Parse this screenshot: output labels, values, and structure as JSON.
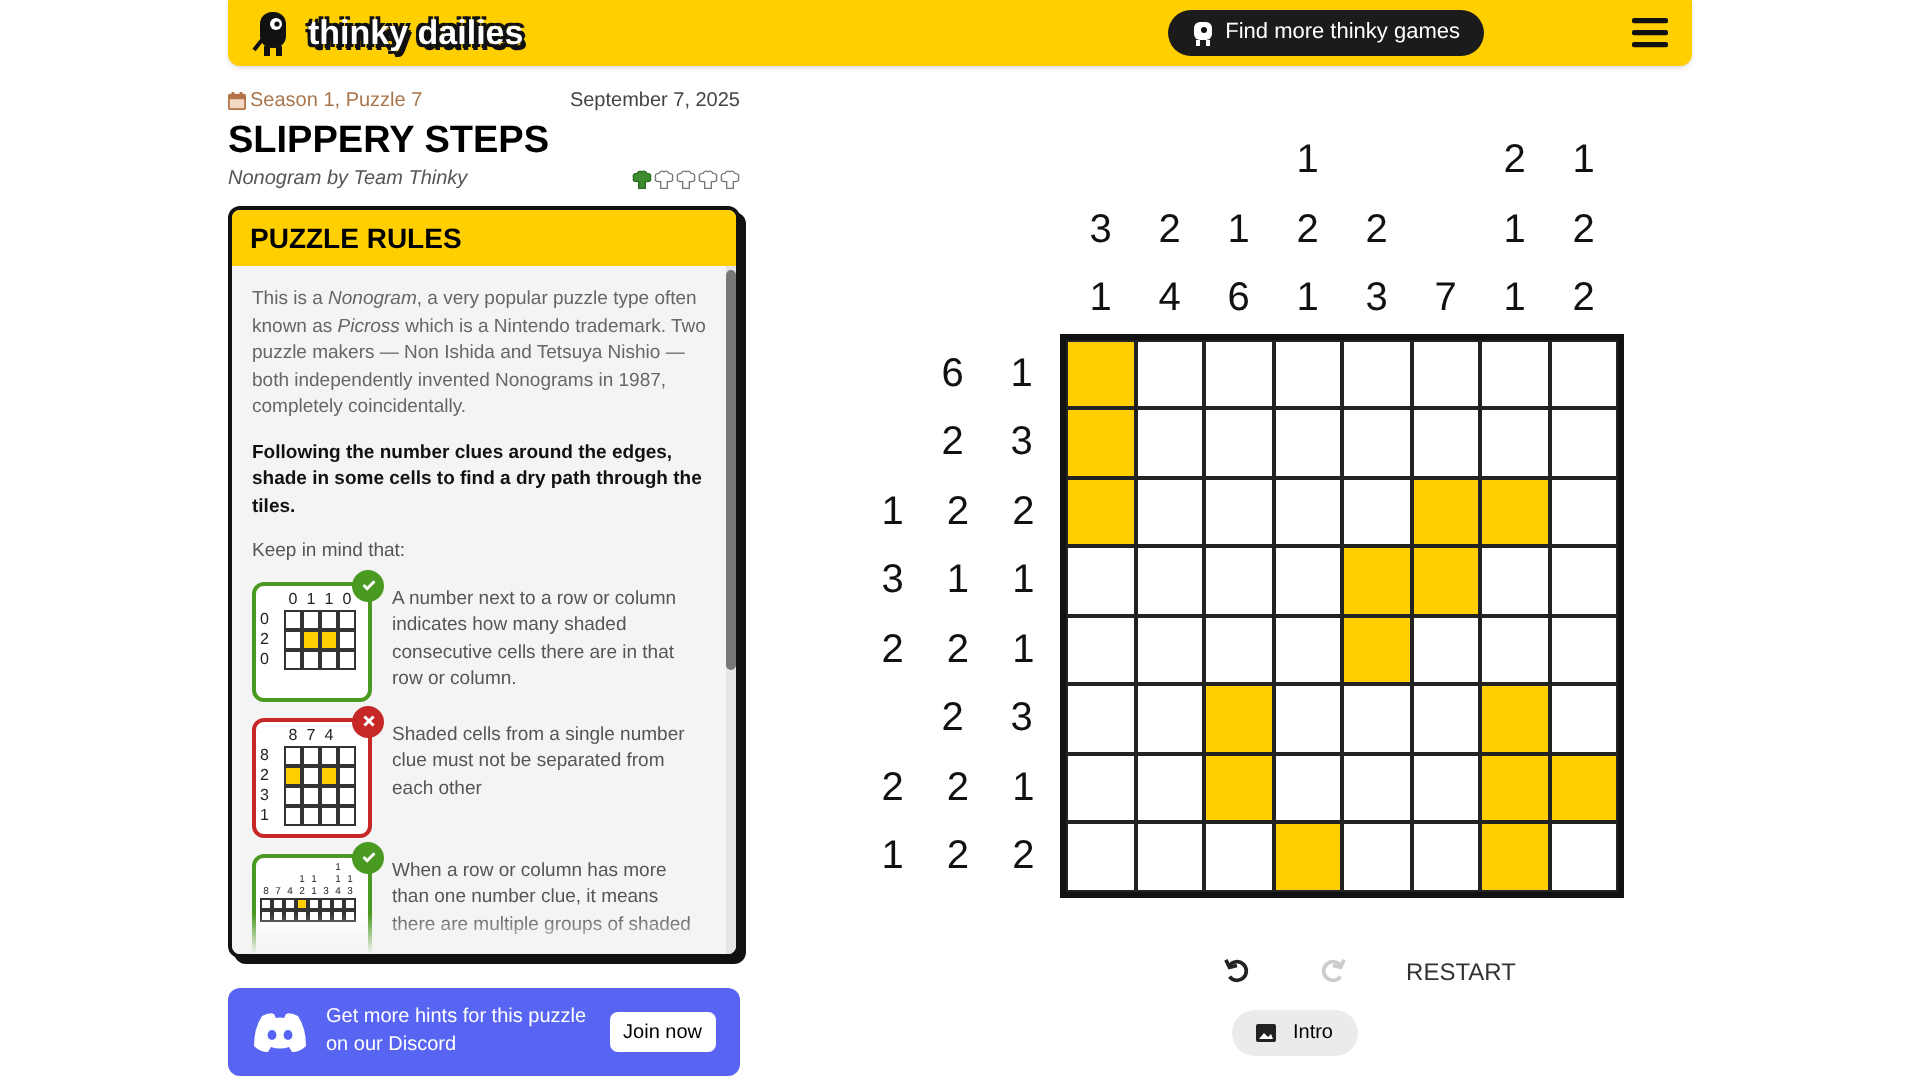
{
  "header": {
    "logo": "thinky dailies",
    "cta": "Find more thinky games"
  },
  "puzzle_info": {
    "season": "Season 1, Puzzle 7",
    "date": "September 7, 2025",
    "title": "SLIPPERY STEPS",
    "byline": "Nonogram by Team Thinky",
    "stars": 1
  },
  "rules": {
    "title": "PUZZLE RULES",
    "intro": "This is a *Nonogram*, a very popular puzzle type often known as *Picross* which is a Nintendo trademark. Two puzzle makers — Non Ishida and Tetsuya Nishio — both independently invented Nonograms in 1987, completely coincidentally.",
    "goal": "Following the number clues around the edges, shade in some cells to find a dry path through the tiles.",
    "keep_in_mind": "Keep in mind that:",
    "examples": [
      {
        "kind": "correct",
        "text": "A number next to a row or column indicates how many shaded consecutive cells there are in that row or column.",
        "column_clue_rows": [
          [
            "0",
            "1",
            "1",
            "0"
          ]
        ],
        "rows": [
          {
            "clues": [
              "0"
            ],
            "cells": [
              false,
              false,
              false,
              false
            ]
          },
          {
            "clues": [
              "2"
            ],
            "cells": [
              false,
              true,
              true,
              false
            ]
          },
          {
            "clues": [
              "0"
            ],
            "cells": [
              false,
              false,
              false,
              false
            ]
          }
        ]
      },
      {
        "kind": "wrong",
        "text": "Shaded cells from a single number clue must not be separated from each other",
        "column_clue_rows": [
          [
            "8",
            "7",
            "4",
            null
          ]
        ],
        "rows": [
          {
            "clues": [
              "8"
            ],
            "cells": [
              false,
              false,
              false,
              false
            ]
          },
          {
            "clues": [
              "2"
            ],
            "cells": [
              true,
              false,
              true,
              false
            ]
          },
          {
            "clues": [
              "3"
            ],
            "cells": [
              false,
              false,
              false,
              false
            ]
          },
          {
            "clues": [
              "1"
            ],
            "cells": [
              false,
              false,
              false,
              false
            ]
          }
        ]
      },
      {
        "kind": "correct",
        "text": "When a row or column has more than one number clue, it means there are multiple groups of shaded",
        "column_clue_rows": [
          [
            null,
            null,
            null,
            null,
            null,
            null,
            "1",
            null
          ],
          [
            null,
            null,
            null,
            "1",
            "1",
            null,
            "1",
            "1"
          ],
          [
            "8",
            "7",
            "4",
            "2",
            "1",
            "3",
            "4",
            "3"
          ]
        ],
        "rows": [
          {
            "clues": [],
            "cells": [
              false,
              false,
              false,
              true,
              false,
              false,
              false,
              false
            ]
          },
          {
            "clues": [],
            "cells": [
              false,
              false,
              false,
              false,
              false,
              false,
              false,
              false
            ]
          }
        ]
      }
    ]
  },
  "discord": {
    "text": "Get more hints for this puzzle on our Discord",
    "button": "Join now"
  },
  "grid": {
    "column_clue_rows": [
      [
        null,
        null,
        null,
        "1",
        null,
        null,
        "2",
        "1"
      ],
      [
        "3",
        "2",
        "1",
        "2",
        "2",
        null,
        "1",
        "2"
      ],
      [
        "1",
        "4",
        "6",
        "1",
        "3",
        "7",
        "1",
        "2"
      ]
    ],
    "rows": [
      {
        "clues": [
          "6",
          "1"
        ],
        "cells": [
          true,
          false,
          false,
          false,
          false,
          false,
          false,
          false
        ]
      },
      {
        "clues": [
          "2",
          "3"
        ],
        "cells": [
          true,
          false,
          false,
          false,
          false,
          false,
          false,
          false
        ]
      },
      {
        "clues": [
          "1",
          "2",
          "2"
        ],
        "cells": [
          true,
          false,
          false,
          false,
          false,
          true,
          true,
          false
        ]
      },
      {
        "clues": [
          "3",
          "1",
          "1"
        ],
        "cells": [
          false,
          false,
          false,
          false,
          true,
          true,
          false,
          false
        ]
      },
      {
        "clues": [
          "2",
          "2",
          "1"
        ],
        "cells": [
          false,
          false,
          false,
          false,
          true,
          false,
          false,
          false
        ]
      },
      {
        "clues": [
          "2",
          "3"
        ],
        "cells": [
          false,
          false,
          true,
          false,
          false,
          false,
          true,
          false
        ]
      },
      {
        "clues": [
          "2",
          "2",
          "1"
        ],
        "cells": [
          false,
          false,
          true,
          false,
          false,
          false,
          true,
          true
        ]
      },
      {
        "clues": [
          "1",
          "2",
          "2"
        ],
        "cells": [
          false,
          false,
          false,
          true,
          false,
          false,
          true,
          false
        ]
      }
    ]
  },
  "controls": {
    "undo_disabled": false,
    "redo_disabled": true,
    "restart": "RESTART",
    "intro": "Intro"
  }
}
